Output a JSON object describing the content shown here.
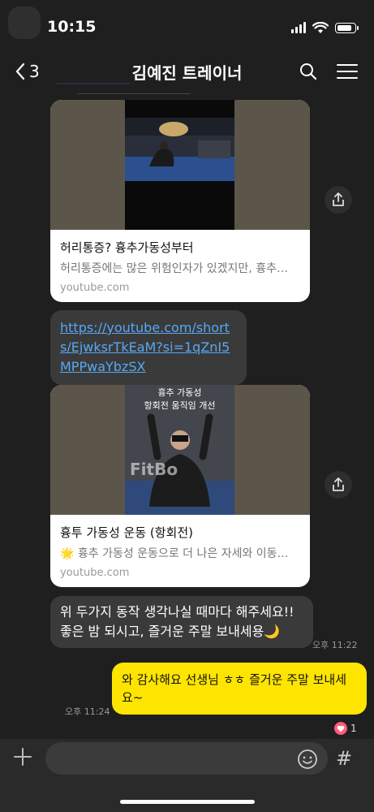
{
  "status": {
    "time": "10:15"
  },
  "header": {
    "back_count": "3",
    "title": "김예진 트레이너"
  },
  "cards": [
    {
      "title": "허리통증? 흉추가동성부터",
      "description": "허리통증에는 많은 위험인자가 있겠지만, 흉추…",
      "domain": "youtube.com",
      "thumb_caption": ""
    },
    {
      "title": "흉투 가동성 운동 (항회전)",
      "description": "🌟 흉추 가동성 운동으로 더 나은 자세와 이동…",
      "domain": "youtube.com",
      "thumb_caption": "흉추 가동성\n항회전 움직임 개선",
      "thumb_watermark": "FitBo"
    }
  ],
  "link_message": {
    "text": "https://youtube.com/shorts/EjwksrTkEaM?si=1qZnI5MPPwaYbzSX"
  },
  "incoming_message": {
    "text": "위 두가지 동작 생각나실 때마다 해주세요!! 좋은 밤 되시고, 즐거운 주말 보내세용🌙",
    "time": "오후 11:22"
  },
  "outgoing_message": {
    "text": "와 감사해요 선생님 ㅎㅎ 즐거운 주말 보내세요~",
    "time": "오후 11:24"
  },
  "reaction": {
    "count": "1"
  },
  "input": {
    "placeholder": ""
  },
  "colors": {
    "background": "#1f1f1f",
    "incoming_bubble": "#3a3a3a",
    "outgoing_bubble": "#fee500",
    "link": "#56a8f5"
  }
}
